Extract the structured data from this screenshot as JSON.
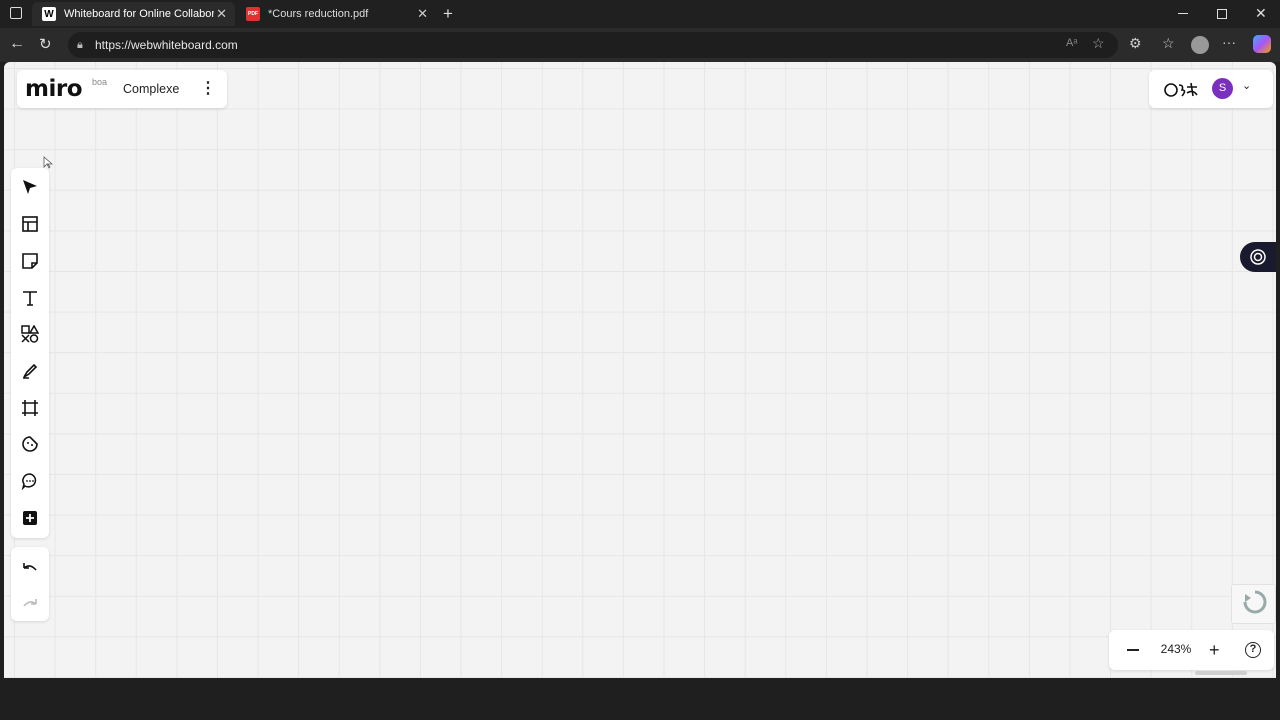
{
  "browser": {
    "tabs": [
      {
        "title": "Whiteboard for Online Collaborati",
        "favicon": "W",
        "active": true
      },
      {
        "title": "*Cours reduction.pdf",
        "favicon": "PDF",
        "active": false
      }
    ],
    "url": "https://webwhiteboard.com"
  },
  "board": {
    "logo": "miro",
    "image_alt": "boa",
    "name": "Complexe",
    "menu_icon": "⋮"
  },
  "toolbar": {
    "tools": [
      "select-icon",
      "templates-icon",
      "sticky-note-icon",
      "text-icon",
      "shapes-icon",
      "pen-icon",
      "frame-icon",
      "sticker-icon",
      "comment-icon",
      "more-tools-icon"
    ],
    "history": [
      "undo-icon",
      "redo-icon"
    ]
  },
  "users": {
    "avatar_initial": "S",
    "accent_color": "#7b2fbe"
  },
  "zoom": {
    "value": "243%"
  },
  "colors": {
    "canvas": "#f3f3f3",
    "grid": "#e6e6e6",
    "panel": "#ffffff"
  }
}
